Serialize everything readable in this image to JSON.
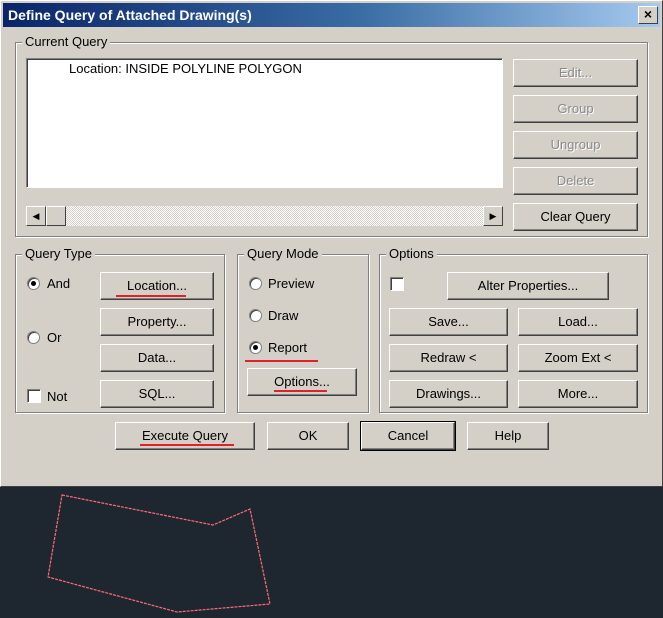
{
  "window": {
    "title": "Define Query of Attached Drawing(s)",
    "close_glyph": "×"
  },
  "current_query": {
    "group_label": "Current Query",
    "items": [
      "Location: INSIDE POLYLINE POLYGON"
    ],
    "buttons": {
      "edit": "Edit...",
      "group": "Group",
      "ungroup": "Ungroup",
      "delete": "Delete",
      "clear": "Clear Query"
    }
  },
  "query_type": {
    "group_label": "Query Type",
    "and_label": "And",
    "or_label": "Or",
    "not_label": "Not",
    "selected": "And",
    "not_checked": false,
    "buttons": {
      "location": "Location...",
      "property": "Property...",
      "data": "Data...",
      "sql": "SQL..."
    }
  },
  "query_mode": {
    "group_label": "Query Mode",
    "preview_label": "Preview",
    "draw_label": "Draw",
    "report_label": "Report",
    "selected": "Report",
    "options_button": "Options..."
  },
  "options": {
    "group_label": "Options",
    "alter_checked": false,
    "buttons": {
      "alter": "Alter Properties...",
      "save": "Save...",
      "load": "Load...",
      "redraw": "Redraw <",
      "zoom": "Zoom Ext <",
      "drawings": "Drawings...",
      "more": "More..."
    }
  },
  "footer": {
    "execute": "Execute Query",
    "ok": "OK",
    "cancel": "Cancel",
    "help": "Help"
  },
  "colors": {
    "dialog_bg": "#d4d0c8",
    "canvas_bg": "#1e2630",
    "highlight_red": "#e0202a",
    "polygon_stroke": "#ff6b7a"
  }
}
